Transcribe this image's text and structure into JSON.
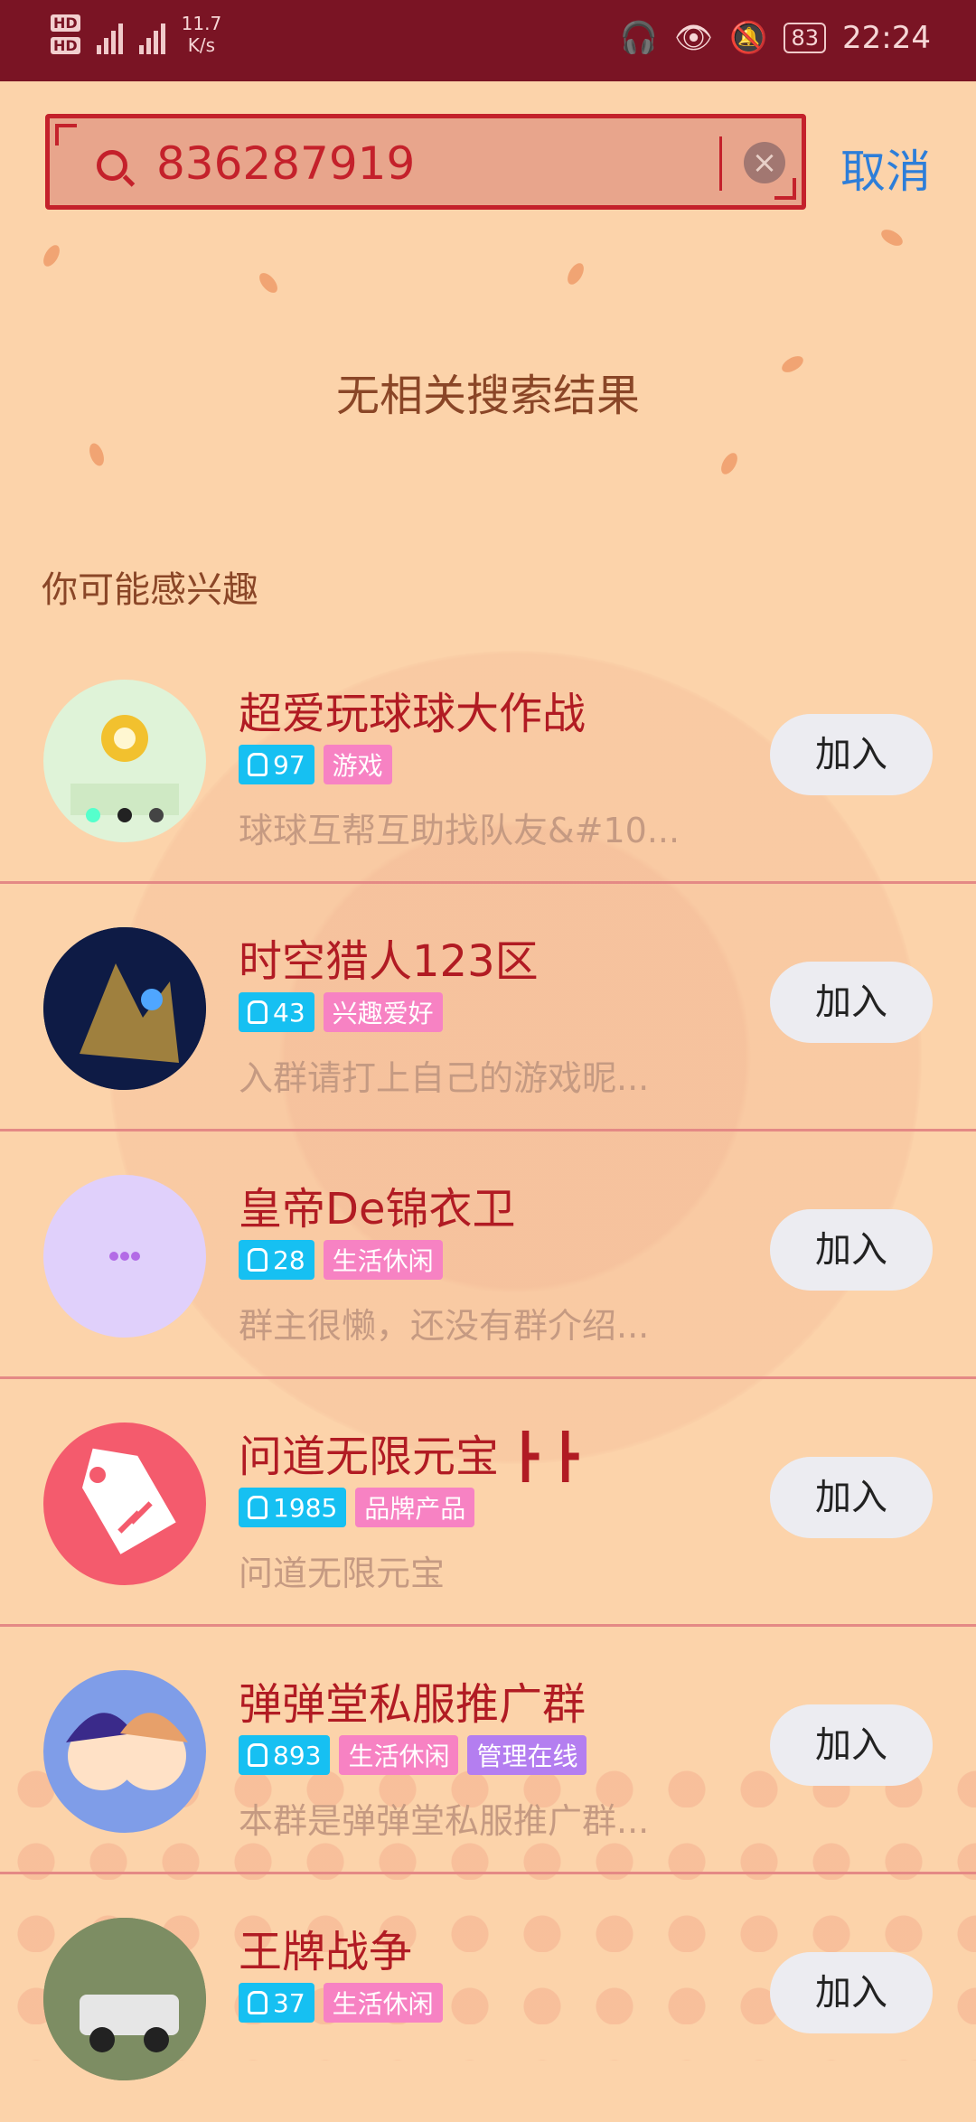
{
  "status_bar": {
    "speed_value": "11.7",
    "speed_unit": "K/s",
    "battery": "83",
    "time": "22:24"
  },
  "search": {
    "value": "836287919",
    "cancel_label": "取消"
  },
  "empty_message": "无相关搜索结果",
  "section_title": "你可能感兴趣",
  "groups": [
    {
      "name": "超爱玩球球大作战",
      "count": "97",
      "tags": [
        "游戏"
      ],
      "desc": "球球互帮互助找队友&#10...",
      "join": "加入"
    },
    {
      "name": "时空猎人123区",
      "count": "43",
      "tags": [
        "兴趣爱好"
      ],
      "desc": "入群请打上自己的游戏昵...",
      "join": "加入"
    },
    {
      "name": "皇帝De锦衣卫",
      "count": "28",
      "tags": [
        "生活休闲"
      ],
      "desc": "群主很懒，还没有群介绍...",
      "join": "加入"
    },
    {
      "name": "问道无限元宝 ┣ ┣",
      "count": "1985",
      "tags": [
        "品牌产品"
      ],
      "desc": "问道无限元宝",
      "join": "加入"
    },
    {
      "name": "弹弹堂私服推广群",
      "count": "893",
      "tags": [
        "生活休闲",
        "管理在线"
      ],
      "desc": "本群是弹弹堂私服推广群...",
      "join": "加入"
    },
    {
      "name": "王牌战争",
      "count": "37",
      "tags": [
        "生活休闲"
      ],
      "desc": "",
      "join": "加入"
    }
  ],
  "colors": {
    "status_bar": "#7a1424",
    "background": "#fcd3aa",
    "accent_red": "#b11b23",
    "count_tag": "#16c0f2",
    "category_tag": "#f782c3",
    "manage_tag": "#b47ef0",
    "cancel_blue": "#2d7ed9"
  }
}
